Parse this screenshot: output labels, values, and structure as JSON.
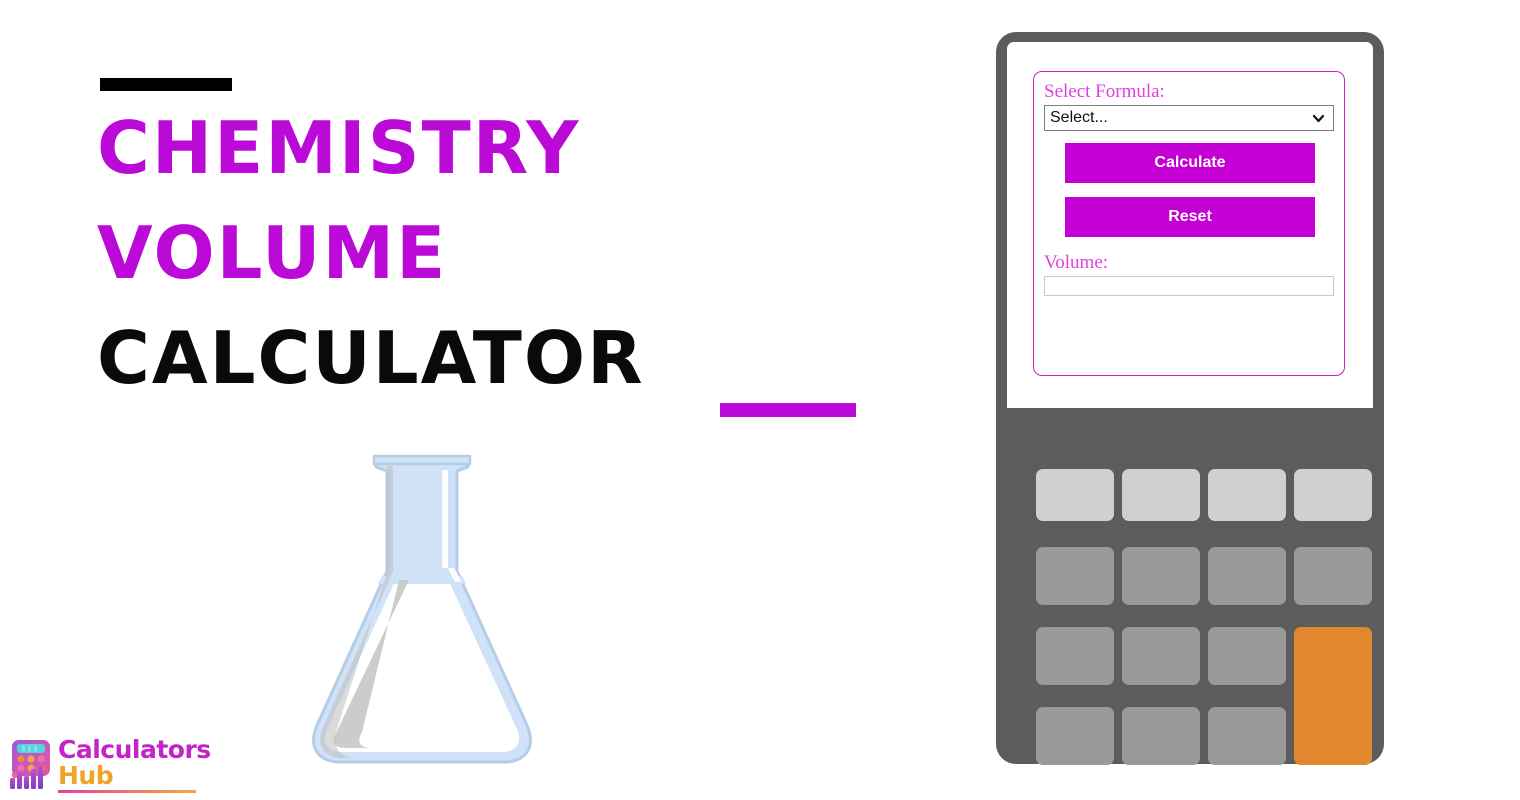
{
  "hero": {
    "accent_bar_top_color": "#000000",
    "accent_bar_bottom_color": "#bb0ad8",
    "title_line1": "CHEMISTRY",
    "title_line2": "VOLUME",
    "title_line3": "CALCULATOR",
    "title_purple_color": "#bb0ad8",
    "title_black_color": "#0a0a0a"
  },
  "illustration": {
    "name": "erlenmeyer-flask",
    "glass_color": "#cfe2f7",
    "outline_color": "#b6cde6",
    "shadow_color": "#c9c9c9"
  },
  "logo": {
    "line1": "Calculators",
    "line2": "Hub",
    "line1_color": "#c423c9",
    "line2_color": "#eca526",
    "icon_name": "calculator-chart-logo-icon"
  },
  "calculator": {
    "body_color": "#5c5c5c",
    "screen_color": "#ffffff",
    "form": {
      "select_label": "Select Formula:",
      "select_value": "Select...",
      "select_options": [
        "Select..."
      ],
      "calculate_label": "Calculate",
      "reset_label": "Reset",
      "volume_label": "Volume:",
      "volume_value": "",
      "volume_placeholder": "",
      "accent_color": "#c400d4",
      "label_color": "#e040e0",
      "card_border_color": "#d11ad1"
    },
    "keypad": {
      "row1_color": "#d0d0d0",
      "key_color": "#999999",
      "accent_key_color": "#e2872e",
      "keys": [
        {
          "label": "",
          "row": 1,
          "col": 1,
          "style": "light"
        },
        {
          "label": "",
          "row": 1,
          "col": 2,
          "style": "light"
        },
        {
          "label": "",
          "row": 1,
          "col": 3,
          "style": "light"
        },
        {
          "label": "",
          "row": 1,
          "col": 4,
          "style": "light"
        },
        {
          "label": "",
          "row": 2,
          "col": 1,
          "style": "gray"
        },
        {
          "label": "",
          "row": 2,
          "col": 2,
          "style": "gray"
        },
        {
          "label": "",
          "row": 2,
          "col": 3,
          "style": "gray"
        },
        {
          "label": "",
          "row": 2,
          "col": 4,
          "style": "gray"
        },
        {
          "label": "",
          "row": 3,
          "col": 1,
          "style": "gray"
        },
        {
          "label": "",
          "row": 3,
          "col": 2,
          "style": "gray"
        },
        {
          "label": "",
          "row": 3,
          "col": 3,
          "style": "gray"
        },
        {
          "label": "",
          "row": 3,
          "col": 4,
          "style": "orange-tall"
        },
        {
          "label": "",
          "row": 4,
          "col": 1,
          "style": "gray"
        },
        {
          "label": "",
          "row": 4,
          "col": 2,
          "style": "gray"
        },
        {
          "label": "",
          "row": 4,
          "col": 3,
          "style": "gray"
        }
      ]
    }
  }
}
